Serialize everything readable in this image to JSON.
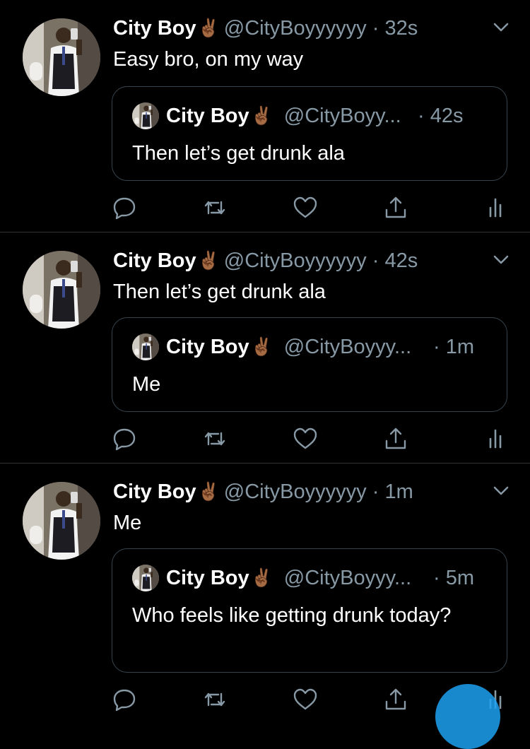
{
  "tweets": [
    {
      "name": "City Boy",
      "emoji": "✌🏾",
      "handle": "@CityBoyyyyyy",
      "dot": "·",
      "time": "32s",
      "text": "Easy bro, on my way",
      "quote": {
        "name": "City Boy",
        "emoji": "✌🏾",
        "handle": "@CityBoyy...",
        "time": "· 42s",
        "text": "Then let’s get drunk ala"
      }
    },
    {
      "name": "City Boy",
      "emoji": "✌🏾",
      "handle": "@CityBoyyyyyy",
      "dot": "·",
      "time": "42s",
      "text": "Then let’s get drunk ala",
      "quote": {
        "name": "City Boy",
        "emoji": "✌🏾",
        "handle": "@CityBoyyy...",
        "time": "· 1m",
        "text": "Me"
      }
    },
    {
      "name": "City Boy",
      "emoji": "✌🏾",
      "handle": "@CityBoyyyyyy",
      "dot": "·",
      "time": "1m",
      "text": "Me",
      "quote": {
        "name": "City Boy",
        "emoji": "✌🏾",
        "handle": "@CityBoyyy...",
        "time": "· 5m",
        "text": "Who feels like getting drunk today?"
      }
    }
  ],
  "icons": {
    "reply": "reply-icon",
    "retweet": "retweet-icon",
    "like": "like-icon",
    "share": "share-icon",
    "analytics": "analytics-icon",
    "menu": "chevron-down-icon"
  },
  "colors": {
    "background": "#000000",
    "text": "#ffffff",
    "secondary": "#8899a6",
    "border": "#38444d",
    "accent": "#1da1f2"
  }
}
